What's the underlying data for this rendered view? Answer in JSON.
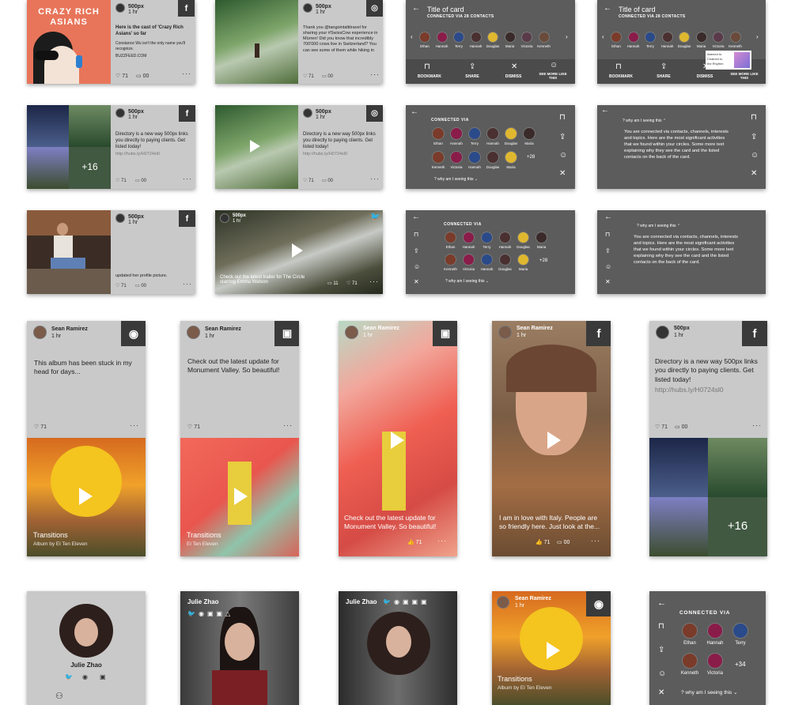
{
  "cards": {
    "crazy": {
      "book_title_1": "CRAZY RICH",
      "book_title_2": "ASIANS",
      "source": "500px",
      "time": "1 hr",
      "headline": "Here is the cast of 'Crazy Rich Asians' so far",
      "sub": "Constance Wu isn't the only name you'll recognize.",
      "domain": "BUZZFEED.COM",
      "likes": "71",
      "comments": "00"
    },
    "hiker": {
      "source": "500px",
      "time": "1 hr",
      "body": "Thank you @tangointaltitravel for sharing your #SwissCow experience in Mürren! Did you know that incredibly 700'000 cows live in Switzerland? You can see some of them while hiking in",
      "likes": "71",
      "comments": "00"
    },
    "directory": {
      "source": "500px",
      "time": "1 hr",
      "body": "Directory is a new way 500px links you directly to paying clients. Get listed today!",
      "link": "http://hubs.ly/H0724sl0",
      "plus": "+16",
      "likes": "71",
      "comments": "00"
    },
    "hiker_video": {
      "source": "500px",
      "time": "1 hr",
      "body": "Directory is a new way 500px links you directly to paying clients. Get listed today!",
      "link": "http://hubs.ly/H0724sl0",
      "likes": "71",
      "comments": "00"
    },
    "profile_pic": {
      "source": "500px",
      "time": "1 hr",
      "body": "updated her profile picture.",
      "likes": "71",
      "comments": "00"
    },
    "trailer": {
      "source": "500px",
      "time": "1 hr",
      "caption": "Check out the latest trailer for The Circle starring Emma Watson",
      "likes": "71",
      "comments": "11"
    }
  },
  "panels": {
    "title_card_1": {
      "title": "Title of card",
      "subtitle": "CONNECTED VIA 28 CONTACTS",
      "actions": [
        "BOOKMARK",
        "SHARE",
        "DISMISS",
        "SEE MORE LIKE THIS"
      ]
    },
    "title_card_2": {
      "title": "Title of card",
      "subtitle": "CONNECTED VIA 28 CONTACTS",
      "tooltip_1": "listened to",
      "tooltip_2": "Chained to",
      "tooltip_3": "the Rhythm",
      "actions": [
        "BOOKMARK",
        "SHARE",
        "DISMISS",
        "SEE MORE LIKE THIS"
      ]
    },
    "connected": {
      "label": "CONNECTED VIA",
      "plus": "+28",
      "why": "why am I seeing this"
    },
    "why": {
      "why": "why am I seeing this",
      "explain": "You are connected via contacts, channels, interests and topics. Here are the most significant activities that we found within your circles. Some more text explaining why they see the card and the listed contacts on the back of the card."
    },
    "connected_big": {
      "label": "CONNECTED VIA",
      "plus": "+34",
      "why": "why am I seeing this"
    }
  },
  "people_row": [
    "Ethan",
    "Hannah",
    "Terry",
    "Hannah",
    "Douglas",
    "Maria",
    "Victoria",
    "Kenneth"
  ],
  "people_grid_1": [
    "Ethan",
    "Hannah",
    "Terry",
    "Hannah",
    "Douglas",
    "Maria"
  ],
  "people_grid_2": [
    "Kenneth",
    "Victoria",
    "Hannah",
    "Douglas",
    "Maria"
  ],
  "people_big_1": [
    "Ethan",
    "Hannah",
    "Terry"
  ],
  "people_big_2": [
    "Kenneth",
    "Victoria"
  ],
  "tall": {
    "album": {
      "user": "Sean Ramirez",
      "time": "1 hr",
      "body": "This album has been stuck in my head for days...",
      "likes": "71",
      "title": "Transitions",
      "sub": "Album by El Ten Eleven"
    },
    "monument": {
      "user": "Sean Ramirez",
      "time": "1 hr",
      "body": "Check out the latest update for Monument Valley. So beautiful!",
      "likes": "71",
      "title": "Transitions",
      "sub": "El Ten Eleven"
    },
    "monument_full": {
      "user": "Sean Ramirez",
      "time": "1 hr",
      "caption": "Check out the latest update for Monument Valley. So beautiful!",
      "likes": "71"
    },
    "italy": {
      "user": "Sean Ramirez",
      "time": "1 hr",
      "caption": "I am in love with Italy. People are so friendly here. Just look at the...",
      "likes": "71",
      "comments": "00"
    },
    "directory_tall": {
      "user": "500px",
      "time": "1 hr",
      "body": "Directory is a new way 500px links you directly to paying clients. Get listed today!",
      "link": "http://hubs.ly/H0724sl0",
      "likes": "71",
      "comments": "00",
      "plus": "+16"
    }
  },
  "bottom": {
    "julie1": {
      "name": "Julie Zhao"
    },
    "julie2": {
      "name": "Julie Zhao"
    },
    "julie3": {
      "name": "Julie Zhao"
    },
    "album2": {
      "user": "Sean Ramirez",
      "time": "1 hr",
      "title": "Transitions",
      "sub": "Album by El Ten Eleven"
    }
  },
  "colors": {
    "panel": "#5c5c5c",
    "card": "#c9c9c9",
    "dark_logo": "#3a3a3a"
  }
}
